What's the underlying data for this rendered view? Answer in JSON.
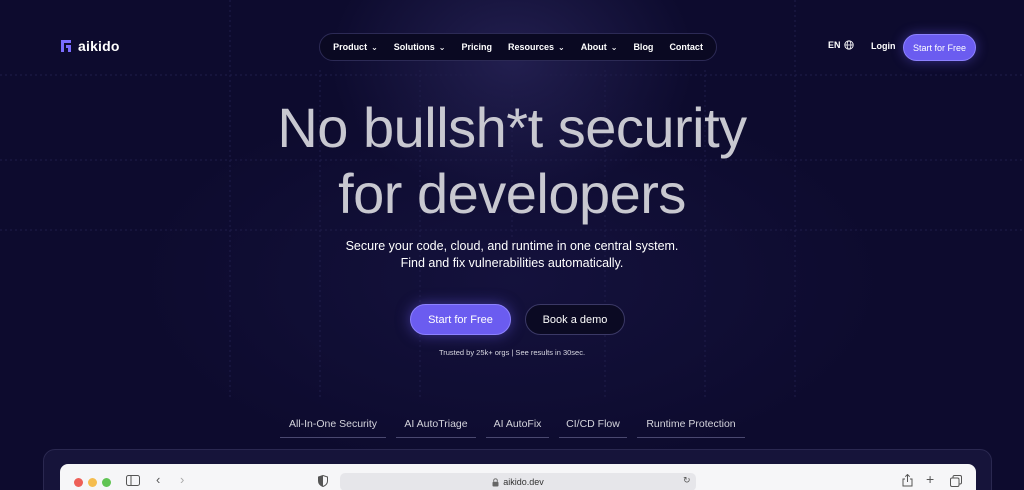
{
  "brand": {
    "name": "aikido",
    "accent": "#6b5cf0"
  },
  "nav": {
    "items": [
      {
        "label": "Product",
        "dropdown": true
      },
      {
        "label": "Solutions",
        "dropdown": true
      },
      {
        "label": "Pricing",
        "dropdown": false
      },
      {
        "label": "Resources",
        "dropdown": true
      },
      {
        "label": "About",
        "dropdown": true
      },
      {
        "label": "Blog",
        "dropdown": false
      },
      {
        "label": "Contact",
        "dropdown": false
      }
    ],
    "language": "EN",
    "login": "Login",
    "cta": "Start for Free"
  },
  "hero": {
    "title_line1": "No bullsh*t security",
    "title_line2": "for developers",
    "subtitle_line1": "Secure your code, cloud, and runtime in one central system.",
    "subtitle_line2": "Find and fix vulnerabilities automatically.",
    "primary_cta": "Start for Free",
    "secondary_cta": "Book a demo",
    "trusted": "Trusted by 25k+ orgs | See results in 30sec."
  },
  "tabs": [
    {
      "label": "All-In-One Security"
    },
    {
      "label": "AI AutoTriage"
    },
    {
      "label": "AI AutoFix"
    },
    {
      "label": "CI/CD Flow"
    },
    {
      "label": "Runtime Protection"
    }
  ],
  "browser_mock": {
    "url": "aikido.dev",
    "dot_colors": [
      "#ee5f57",
      "#f5bd4f",
      "#61c454"
    ],
    "icons": [
      "sidebar-icon",
      "back-icon",
      "forward-icon",
      "shield-icon",
      "lock-icon",
      "reload-icon",
      "share-icon",
      "plus-icon",
      "tabs-icon"
    ]
  }
}
